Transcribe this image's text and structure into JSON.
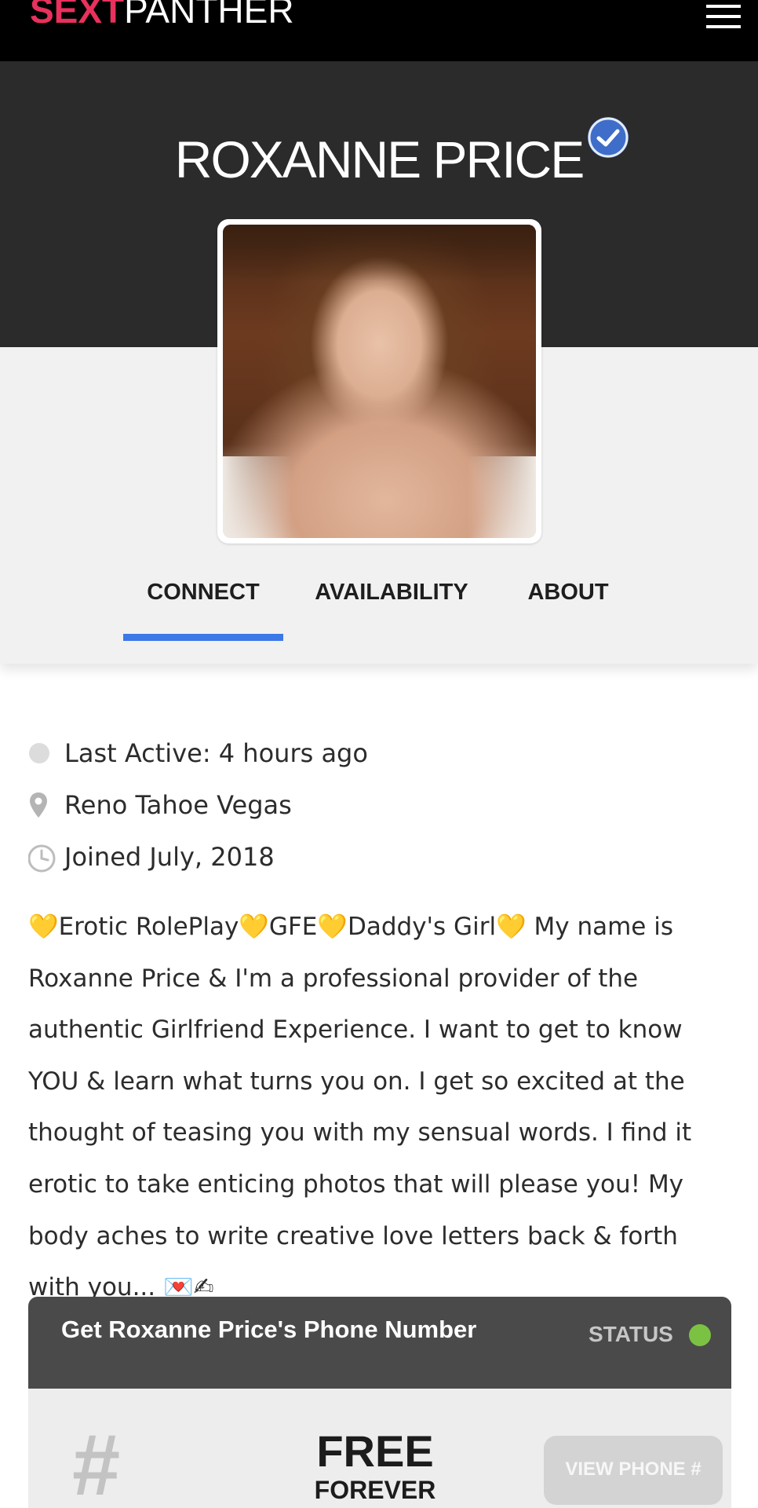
{
  "header": {
    "logo_part1": "SEXT",
    "logo_part2": "PANTHER",
    "menu_icon": "hamburger-menu-icon"
  },
  "profile": {
    "name": "ROXANNE PRICE",
    "verified_icon": "verified-check-icon",
    "photo_alt": "Roxanne Price profile photo"
  },
  "tabs": [
    {
      "label": "CONNECT",
      "active": true
    },
    {
      "label": "AVAILABILITY",
      "active": false
    },
    {
      "label": "ABOUT",
      "active": false
    }
  ],
  "meta": {
    "last_active": "Last Active: 4 hours ago",
    "location": "Reno Tahoe Vegas",
    "joined": "Joined July, 2018",
    "icons": [
      "status-dot-icon",
      "map-pin-icon",
      "clock-icon"
    ]
  },
  "bio": "💛Erotic RolePlay💛GFE💛Daddy's Girl💛 My name is Roxanne Price & I'm a professional provider of the authentic Girlfriend Experience. I want to get to know YOU & learn what turns you on. I get so excited at the thought of teasing you with my sensual words. I find it erotic to take enticing photos that will please you! My body aches to write creative love letters back & forth with you... 💌✍",
  "phone_card": {
    "title": "Get Roxanne Price's Phone Number",
    "status_label": "STATUS",
    "status_color": "#7cc242",
    "hash_symbol": "#",
    "price_big": "FREE",
    "price_small": "FOREVER",
    "button_label": "VIEW PHONE #"
  },
  "colors": {
    "brand_pink": "#e8315d",
    "accent_blue": "#3c78e6",
    "verified_blue": "#3e6ec9"
  }
}
